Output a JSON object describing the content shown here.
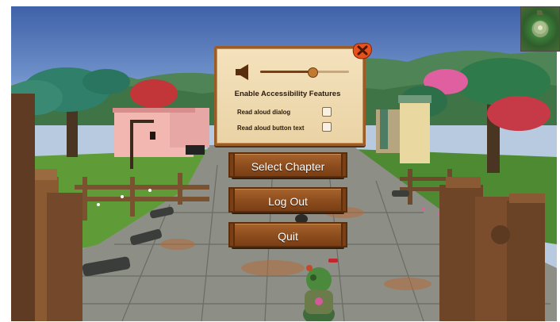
{
  "accessibility_panel": {
    "title": "Enable Accessibility Features",
    "volume_level": 0.58,
    "options": [
      {
        "label": "Read aloud dialog",
        "checked": false
      },
      {
        "label": "Read aloud button text",
        "checked": false
      }
    ],
    "close_icon": "close-x-icon",
    "speaker_icon": "speaker-icon",
    "close_color": "#e8501c"
  },
  "menu": {
    "select_chapter_label": "Select Chapter",
    "log_out_label": "Log Out",
    "quit_label": "Quit"
  },
  "colors": {
    "button_wood": "#8c4c1d",
    "panel_parchment": "#f0dcb2",
    "panel_border": "#9c5c26"
  }
}
